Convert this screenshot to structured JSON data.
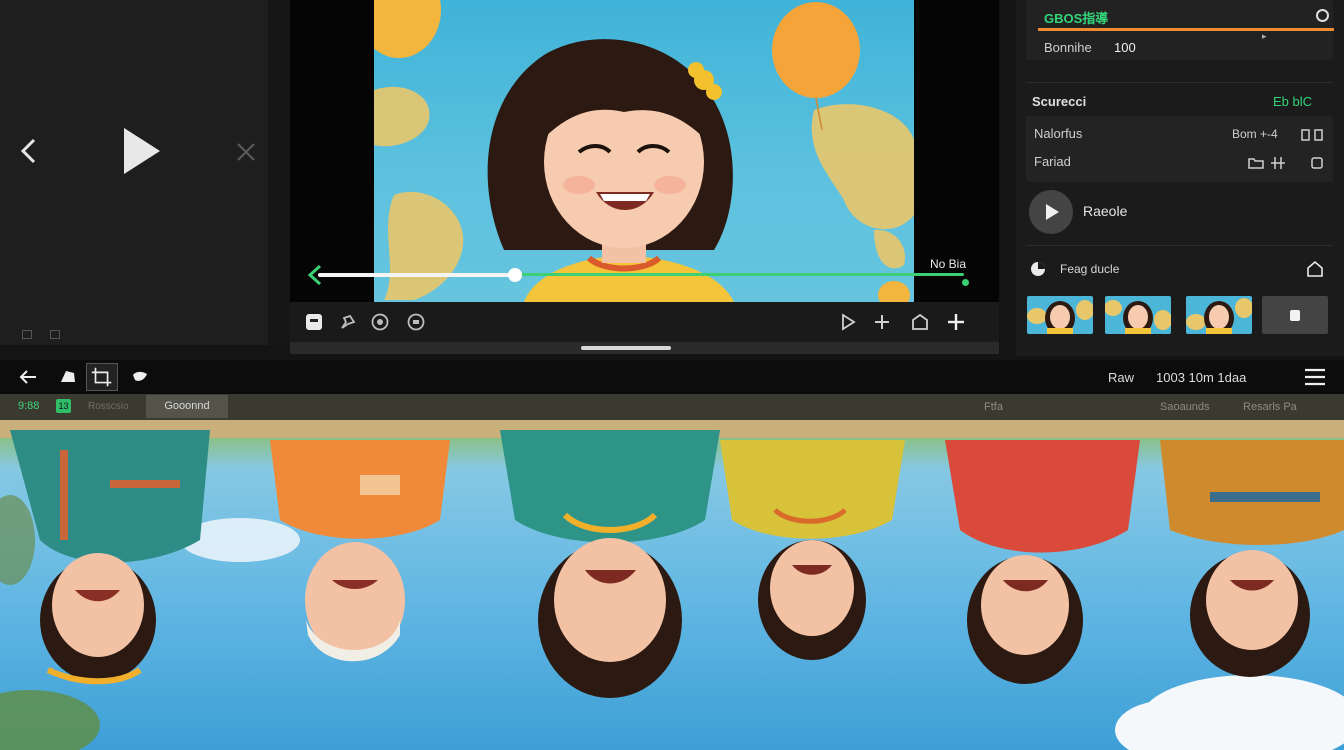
{
  "viewer": {
    "tag": "No Bia",
    "controls_left": [
      "note-icon",
      "pin-icon",
      "circle-icon",
      "record-icon"
    ],
    "controls_right": [
      "play-outline-icon",
      "plus-icon",
      "home-icon",
      "add-icon"
    ]
  },
  "inspector": {
    "title": "GBOS指導",
    "value_label": "Bonnihe",
    "value": "100",
    "section_header": "Scurecci",
    "section_header_right": "Eb blC",
    "rows": [
      {
        "label": "Nalorfus",
        "right": "Bom +-4"
      },
      {
        "label": "Fariad",
        "right": ""
      }
    ],
    "play_label": "Raeole",
    "thumbs_header": "Feag ducle"
  },
  "toolbar": {
    "right_label_1": "Raw",
    "right_label_2": "1003 10m 1daa"
  },
  "tabs": {
    "active": "9:88",
    "active_badge": "13",
    "tab2": "Rosscsio",
    "tab3": "Gooonnd",
    "right_1": "Ftfa",
    "right_2": "Saoaunds",
    "right_3": "Resarls Pa"
  },
  "colors": {
    "accent_green": "#33d57a",
    "accent_orange": "#f08a2e",
    "panel_bg": "#1b1b1b"
  }
}
